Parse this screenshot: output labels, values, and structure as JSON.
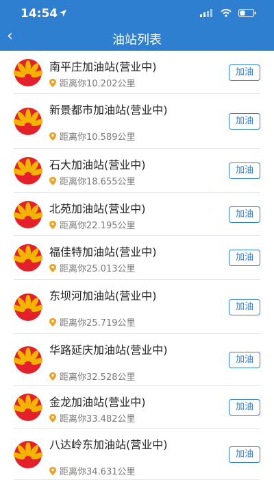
{
  "status_bar": {
    "time": "14:54"
  },
  "header": {
    "back_label": "‹",
    "title": "油站列表"
  },
  "stations": [
    {
      "name": "南平庄加油站(营业中)",
      "distance": "距离你10.202公里",
      "action": "加油"
    },
    {
      "name": "新景都市加油站(营业中)",
      "distance": "距离你10.589公里",
      "action": "加油"
    },
    {
      "name": "石大加油站(营业中)",
      "distance": "距离你18.655公里",
      "action": "加油"
    },
    {
      "name": "北苑加油站(营业中)",
      "distance": "距离你22.195公里",
      "action": "加油"
    },
    {
      "name": "福佳特加油站(营业中)",
      "distance": "距离你25.013公里",
      "action": "加油"
    },
    {
      "name": "东坝河加油站(营业中)",
      "distance": "距离你25.719公里",
      "action": "加油"
    },
    {
      "name": "华路延庆加油站(营业中)",
      "distance": "距离你32.528公里",
      "action": "加油"
    },
    {
      "name": "金龙加油站(营业中)",
      "distance": "距离你33.482公里",
      "action": "加油"
    },
    {
      "name": "八达岭东加油站(营业中)",
      "distance": "距离你34.631公里",
      "action": "加油"
    }
  ],
  "colors": {
    "header": "#2f7fd0",
    "logo_red": "#e4202a",
    "logo_yellow": "#f2b400",
    "pin": "#f0a020"
  },
  "icons": {
    "logo": "petrochina-logo",
    "pin": "location-pin-icon",
    "back": "back-arrow-icon",
    "location_arrow": "location-arrow-icon"
  }
}
